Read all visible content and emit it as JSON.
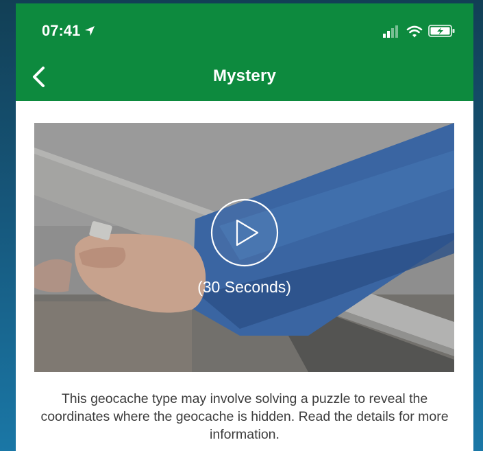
{
  "status_bar": {
    "time": "07:41",
    "location_icon": "location-arrow-icon",
    "signal_icon": "signal-bars-icon",
    "wifi_icon": "wifi-icon",
    "battery_icon": "battery-charging-icon"
  },
  "nav": {
    "title": "Mystery",
    "back_icon": "chevron-left-icon"
  },
  "video": {
    "duration_label": "(30 Seconds)",
    "play_icon": "play-circle-icon"
  },
  "description": "This geocache type may involve solving a puzzle to reveal the coordinates where the geocache is hidden. Read the details for more information.",
  "colors": {
    "header_green": "#0d8a3e",
    "background_blue": "#1a6a96",
    "text": "#3c3c3c"
  }
}
